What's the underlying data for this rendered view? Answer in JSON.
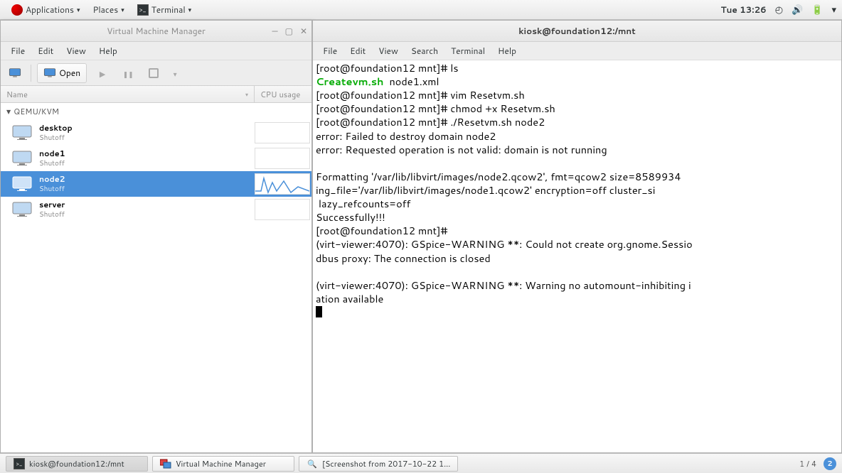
{
  "top_panel": {
    "applications": "Applications",
    "places": "Places",
    "terminal": "Terminal",
    "clock": "Tue 13:26"
  },
  "vmm": {
    "title": "Virtual Machine Manager",
    "menu": {
      "file": "File",
      "edit": "Edit",
      "view": "View",
      "help": "Help"
    },
    "toolbar": {
      "open": "Open"
    },
    "columns": {
      "name": "Name",
      "cpu": "CPU usage"
    },
    "group": "QEMU/KVM",
    "vms": [
      {
        "name": "desktop",
        "status": "Shutoff",
        "selected": false
      },
      {
        "name": "node1",
        "status": "Shutoff",
        "selected": false
      },
      {
        "name": "node2",
        "status": "Shutoff",
        "selected": true
      },
      {
        "name": "server",
        "status": "Shutoff",
        "selected": false
      }
    ]
  },
  "terminal": {
    "title": "kiosk@foundation12:/mnt",
    "menu": {
      "file": "File",
      "edit": "Edit",
      "view": "View",
      "search": "Search",
      "terminal": "Terminal",
      "help": "Help"
    },
    "lines": {
      "l1a": "[root@foundation12 mnt]# ls",
      "l2a": "Createvm.sh",
      "l2b": "  node1.xml",
      "l3": "[root@foundation12 mnt]# vim Resetvm.sh",
      "l4": "[root@foundation12 mnt]# chmod +x Resetvm.sh",
      "l5": "[root@foundation12 mnt]# ./Resetvm.sh node2",
      "l6": "error: Failed to destroy domain node2",
      "l7": "error: Requested operation is not valid: domain is not running",
      "l8": "",
      "l9": "Formatting '/var/lib/libvirt/images/node2.qcow2', fmt=qcow2 size=8589934",
      "l10": "ing_file='/var/lib/libvirt/images/node1.qcow2' encryption=off cluster_si",
      "l11": " lazy_refcounts=off",
      "l12": "Successfully!!!",
      "l13": "[root@foundation12 mnt]# ",
      "l14": "(virt-viewer:4070): GSpice-WARNING **: Could not create org.gnome.Sessio",
      "l15": "dbus proxy: The connection is closed",
      "l16": "",
      "l17": "(virt-viewer:4070): GSpice-WARNING **: Warning no automount-inhibiting i",
      "l18": "ation available"
    }
  },
  "taskbar": {
    "t1": "kiosk@foundation12:/mnt",
    "t2": "Virtual Machine Manager",
    "t3": "[Screenshot from 2017-10-22 1...",
    "workspace": "1 / 4",
    "badge": "2"
  }
}
